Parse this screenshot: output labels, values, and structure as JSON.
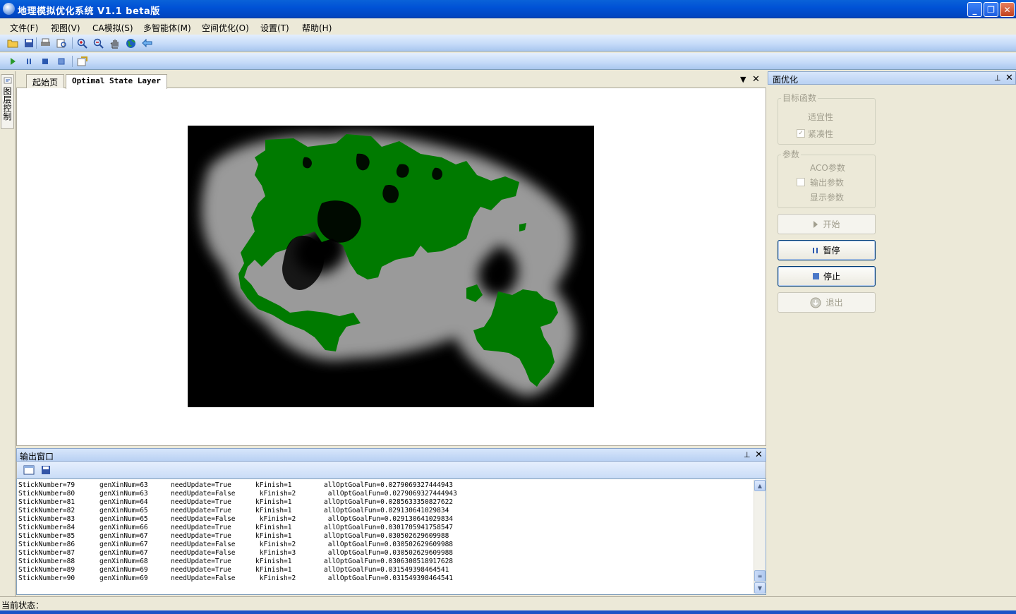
{
  "window": {
    "title": "地理模拟优化系统 V1.1 beta版",
    "controls": {
      "minimize": "_",
      "maximize": "❐",
      "close": "✕"
    }
  },
  "menu": [
    "文件(F)",
    "视图(V)",
    "CA模拟(S)",
    "多智能体(M)",
    "空间优化(O)",
    "设置(T)",
    "帮助(H)"
  ],
  "toolbar1_icons": [
    "open-folder-icon",
    "save-icon",
    "print-icon",
    "print-preview-icon",
    "zoom-in-icon",
    "zoom-out-icon",
    "pan-hand-icon",
    "globe-icon",
    "back-arrow-icon"
  ],
  "toolbar2_icons": [
    "play-icon",
    "pause-icon",
    "stop-icon",
    "step-icon",
    "properties-icon"
  ],
  "left_dock": {
    "label": "图层控制"
  },
  "doc_tabs": [
    {
      "label": "起始页",
      "active": false
    },
    {
      "label": "Optimal State Layer",
      "active": true
    }
  ],
  "map": {
    "background": "#000000",
    "patch_color": "#007a00"
  },
  "output": {
    "title": "输出窗口",
    "rows": [
      [
        "StickNumber=79",
        "genXinNum=63",
        "needUpdate=True",
        "kFinish=1",
        "allOptGoalFun=0.0279069327444943"
      ],
      [
        "StickNumber=80",
        "genXinNum=63",
        "needUpdate=False",
        " kFinish=2",
        " allOptGoalFun=0.0279069327444943"
      ],
      [
        "StickNumber=81",
        "genXinNum=64",
        "needUpdate=True",
        "kFinish=1",
        "allOptGoalFun=0.0285633350827622"
      ],
      [
        "StickNumber=82",
        "genXinNum=65",
        "needUpdate=True",
        "kFinish=1",
        "allOptGoalFun=0.029130641029834"
      ],
      [
        "StickNumber=83",
        "genXinNum=65",
        "needUpdate=False",
        " kFinish=2",
        " allOptGoalFun=0.029130641029834"
      ],
      [
        "StickNumber=84",
        "genXinNum=66",
        "needUpdate=True",
        "kFinish=1",
        "allOptGoalFun=0.0301705941758547"
      ],
      [
        "StickNumber=85",
        "genXinNum=67",
        "needUpdate=True",
        "kFinish=1",
        "allOptGoalFun=0.030502629609988"
      ],
      [
        "StickNumber=86",
        "genXinNum=67",
        "needUpdate=False",
        " kFinish=2",
        " allOptGoalFun=0.030502629609988"
      ],
      [
        "StickNumber=87",
        "genXinNum=67",
        "needUpdate=False",
        " kFinish=3",
        " allOptGoalFun=0.030502629609988"
      ],
      [
        "StickNumber=88",
        "genXinNum=68",
        "needUpdate=True",
        "kFinish=1",
        "allOptGoalFun=0.0306308518917628"
      ],
      [
        "StickNumber=89",
        "genXinNum=69",
        "needUpdate=True",
        "kFinish=1",
        "allOptGoalFun=0.031549398464541"
      ],
      [
        "StickNumber=90",
        "genXinNum=69",
        "needUpdate=False",
        " kFinish=2",
        " allOptGoalFun=0.031549398464541"
      ]
    ]
  },
  "right_panel": {
    "title": "面优化",
    "objective_group": {
      "label": "目标函数",
      "suitability": "适宜性",
      "compactness": "紧凑性",
      "compactness_checked": true
    },
    "params_group": {
      "label": "参数",
      "aco": "ACO参数",
      "output": "输出参数",
      "display": "显示参数"
    },
    "buttons": {
      "start": "开始",
      "pause": "暂停",
      "stop": "停止",
      "exit": "退出"
    }
  },
  "status": {
    "label": "当前状态："
  }
}
